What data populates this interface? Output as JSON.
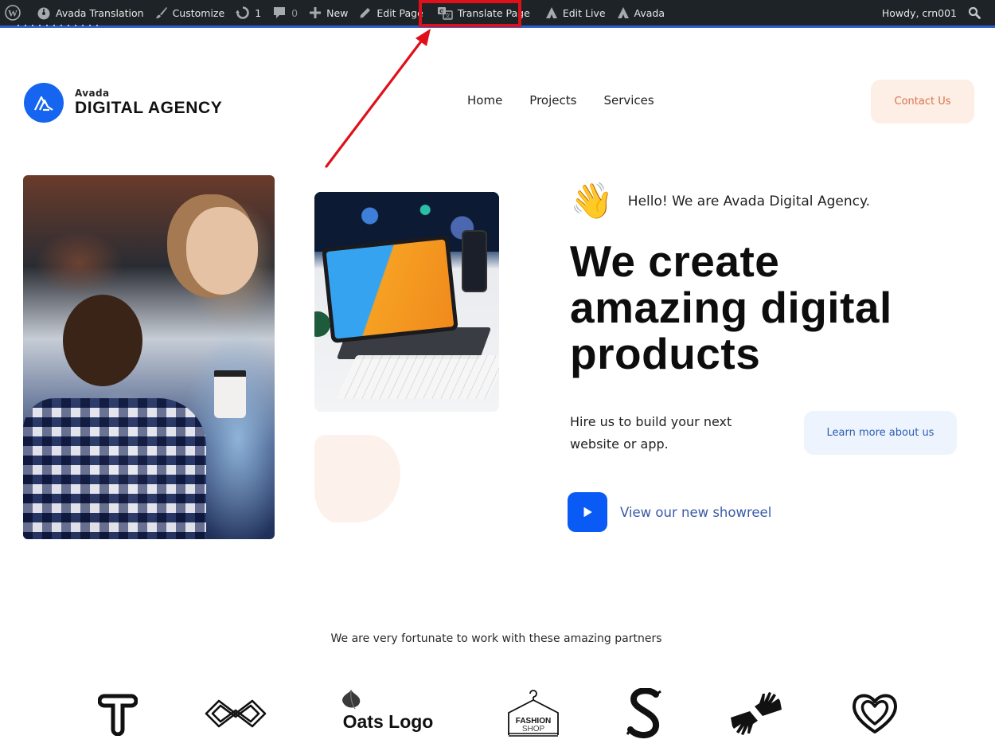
{
  "admin_bar": {
    "site_name": "Avada Translation",
    "customize": "Customize",
    "updates_count": "1",
    "comments_count": "0",
    "new": "New",
    "edit_page": "Edit Page",
    "translate_page": "Translate Page",
    "edit_live": "Edit Live",
    "avada": "Avada",
    "greeting": "Howdy, crn001"
  },
  "annotation": {
    "highlight_target": "Translate Page",
    "color": "#e0101a"
  },
  "header": {
    "logo_small": "Avada",
    "logo_big": "DIGITAL AGENCY",
    "nav": [
      "Home",
      "Projects",
      "Services"
    ],
    "contact_button": "Contact Us"
  },
  "hero": {
    "wave_emoji": "👋",
    "hello": "Hello! We are Avada Digital Agency.",
    "headline": [
      "We create",
      "amazing digital",
      "products"
    ],
    "subtext": "Hire us to build your next website or app.",
    "learn_button": "Learn more about us",
    "showreel_label": "View our new showreel",
    "images": {
      "left": "people-office-photo",
      "right": "tablet-devices-photo"
    }
  },
  "partners": {
    "title": "We are very fortunate to work with these amazing partners",
    "logos": [
      {
        "name": "t-logo"
      },
      {
        "name": "infinity-logo"
      },
      {
        "name": "oats-logo",
        "text": "Oats Logo"
      },
      {
        "name": "fashion-shop-logo",
        "text_top": "FASHION",
        "text_bottom": "SHOP"
      },
      {
        "name": "s-logo"
      },
      {
        "name": "hands-logo"
      },
      {
        "name": "heart-logo"
      }
    ]
  },
  "colors": {
    "admin_bar_bg": "#1d2327",
    "brand_blue": "#1565f0",
    "play_blue": "#0a5af5",
    "contact_bg": "#fdeee6",
    "contact_text": "#d9744c",
    "learn_bg": "#eef4fd",
    "learn_text": "#2b5db8"
  }
}
